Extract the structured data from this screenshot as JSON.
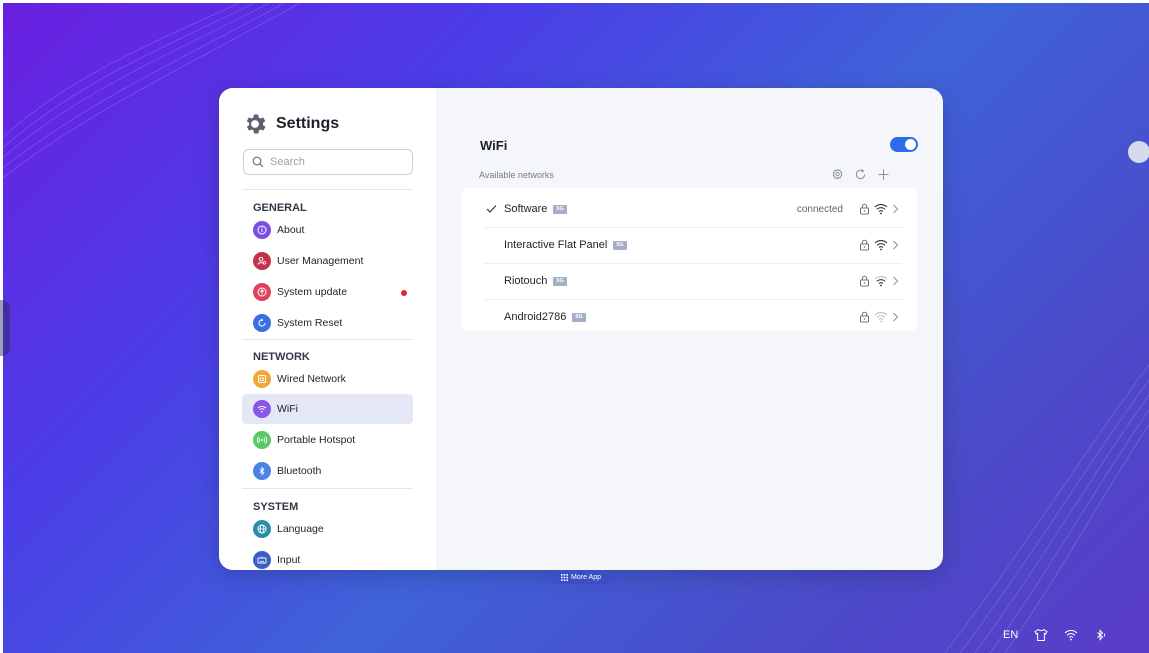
{
  "app": {
    "title": "Settings",
    "search_placeholder": "Search"
  },
  "sidebar": {
    "sections": [
      {
        "title": "GENERAL",
        "items": [
          {
            "label": "About",
            "icon": "info-icon",
            "color": "#7a4de6"
          },
          {
            "label": "User Management",
            "icon": "user-icon",
            "color": "#c2334b"
          },
          {
            "label": "System update",
            "icon": "update-icon",
            "color": "#e0415a",
            "notification": true
          },
          {
            "label": "System Reset",
            "icon": "reset-icon",
            "color": "#3a6fe0"
          }
        ]
      },
      {
        "title": "NETWORK",
        "items": [
          {
            "label": "Wired Network",
            "icon": "ethernet-icon",
            "color": "#f0a83a"
          },
          {
            "label": "WiFi",
            "icon": "wifi-icon",
            "color": "#8a55e8",
            "active": true
          },
          {
            "label": "Portable Hotspot",
            "icon": "hotspot-icon",
            "color": "#5cc86a"
          },
          {
            "label": "Bluetooth",
            "icon": "bluetooth-icon",
            "color": "#4a82e8"
          }
        ]
      },
      {
        "title": "SYSTEM",
        "items": [
          {
            "label": "Language",
            "icon": "globe-icon",
            "color": "#2a8ea8"
          },
          {
            "label": "Input",
            "icon": "keyboard-icon",
            "color": "#3a5fc8"
          }
        ]
      }
    ]
  },
  "wifi": {
    "title": "WiFi",
    "enabled": true,
    "available_label": "Available networks",
    "networks": [
      {
        "name": "Software",
        "band": "5G",
        "status": "connected",
        "connected": true,
        "signal": "strong"
      },
      {
        "name": "Interactive Flat Panel",
        "band": "5G",
        "status": "",
        "connected": false,
        "signal": "strong"
      },
      {
        "name": "Riotouch",
        "band": "5G",
        "status": "",
        "connected": false,
        "signal": "medium"
      },
      {
        "name": "Android2786",
        "band": "5G",
        "status": "",
        "connected": false,
        "signal": "weak"
      }
    ]
  },
  "dock": {
    "more_app_label": "More App"
  },
  "statusbar": {
    "language": "EN"
  },
  "colors": {
    "accent": "#2e6be6",
    "active_bg": "#e4e8f6",
    "notification": "#e0243a"
  }
}
